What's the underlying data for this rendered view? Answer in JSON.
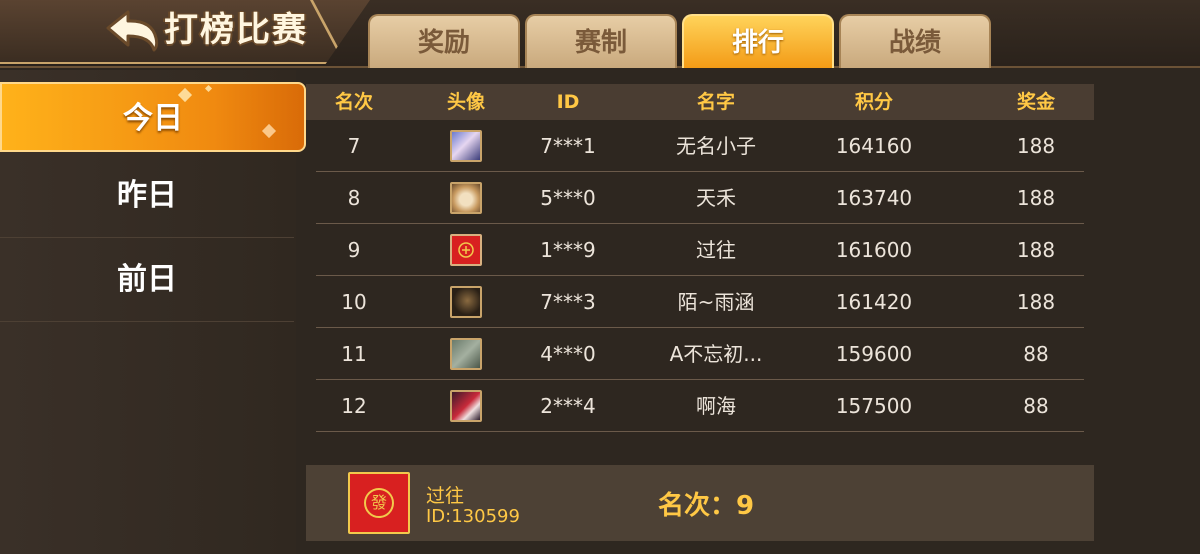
{
  "header": {
    "title": "打榜比赛",
    "back_icon": "back-arrow-icon"
  },
  "tabs": [
    {
      "label": "奖励",
      "active": false
    },
    {
      "label": "赛制",
      "active": false
    },
    {
      "label": "排行",
      "active": true
    },
    {
      "label": "战绩",
      "active": false
    }
  ],
  "nav": [
    {
      "label": "今日",
      "active": true
    },
    {
      "label": "昨日",
      "active": false
    },
    {
      "label": "前日",
      "active": false
    }
  ],
  "table": {
    "columns": [
      "名次",
      "头像",
      "ID",
      "名字",
      "积分",
      "奖金"
    ],
    "rows": [
      {
        "rank": "7",
        "avatar": "anime-avatar",
        "id": "7***1",
        "name": "无名小子",
        "score": "164160",
        "prize": "188"
      },
      {
        "rank": "8",
        "avatar": "cat-avatar",
        "id": "5***0",
        "name": "天禾",
        "score": "163740",
        "prize": "188"
      },
      {
        "rank": "9",
        "avatar": "fa-tile-avatar",
        "id": "1***9",
        "name": "过往",
        "score": "161600",
        "prize": "188"
      },
      {
        "rank": "10",
        "avatar": "dark-portrait-avatar",
        "id": "7***3",
        "name": "陌~雨涵",
        "score": "161420",
        "prize": "188"
      },
      {
        "rank": "11",
        "avatar": "landscape-avatar",
        "id": "4***0",
        "name": "A不忘初...",
        "score": "159600",
        "prize": "88"
      },
      {
        "rank": "12",
        "avatar": "red-portrait-avatar",
        "id": "2***4",
        "name": "啊海",
        "score": "157500",
        "prize": "88"
      }
    ]
  },
  "me": {
    "avatar_glyph": "發",
    "name": "过往",
    "id": "ID:130599",
    "rank_text": "名次：9"
  },
  "colors": {
    "accent": "#ffc845",
    "active_tab": "#f39b16",
    "avatar_red": "#d82020"
  }
}
